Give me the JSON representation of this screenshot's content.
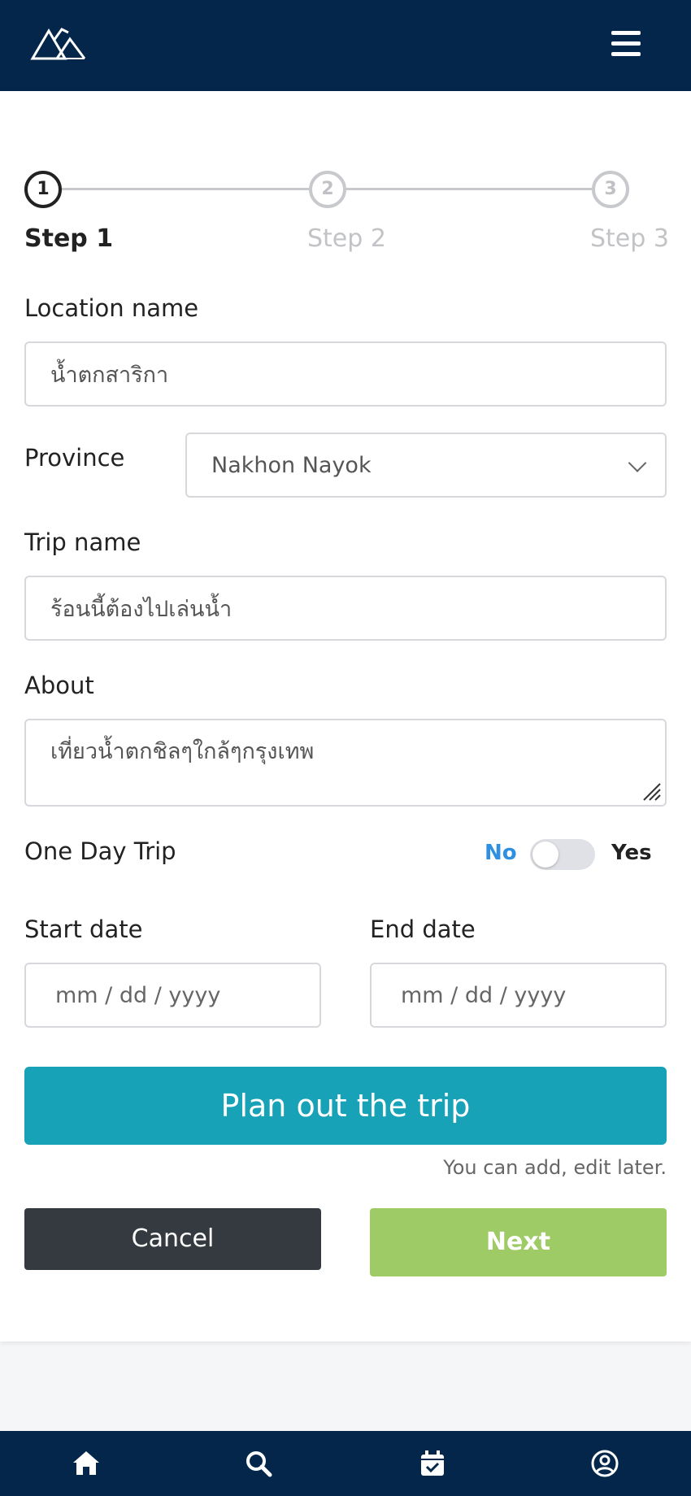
{
  "header": {
    "logo_icon": "mountain-logo-icon",
    "menu_icon": "hamburger-menu-icon"
  },
  "steps": [
    {
      "number": "1",
      "label": "Step 1",
      "active": true
    },
    {
      "number": "2",
      "label": "Step 2",
      "active": false
    },
    {
      "number": "3",
      "label": "Step 3",
      "active": false
    }
  ],
  "form": {
    "location_label": "Location name",
    "location_value": "น้ำตกสาริกา",
    "province_label": "Province",
    "province_value": "Nakhon Nayok",
    "trip_name_label": "Trip name",
    "trip_name_value": "ร้อนนี้ต้องไปเล่นน้ำ",
    "about_label": "About",
    "about_value": "เที่ยวน้ำตกชิลๆใกล้ๆกรุงเทพ",
    "one_day_label": "One Day Trip",
    "toggle_no": "No",
    "toggle_yes": "Yes",
    "toggle_state": "No",
    "start_label": "Start date",
    "start_placeholder": "mm / dd / yyyy",
    "end_label": "End date",
    "end_placeholder": "mm / dd / yyyy"
  },
  "actions": {
    "plan_label": "Plan out the trip",
    "hint": "You can add, edit later.",
    "cancel_label": "Cancel",
    "next_label": "Next"
  },
  "colors": {
    "navbar": "#03264a",
    "plan_button": "#17a2b8",
    "next_button": "#9fcb67",
    "cancel_button": "#343a40",
    "toggle_active": "#2f8fe0"
  },
  "bottom_nav": [
    "home-icon",
    "search-icon",
    "calendar-check-icon",
    "user-circle-icon"
  ]
}
